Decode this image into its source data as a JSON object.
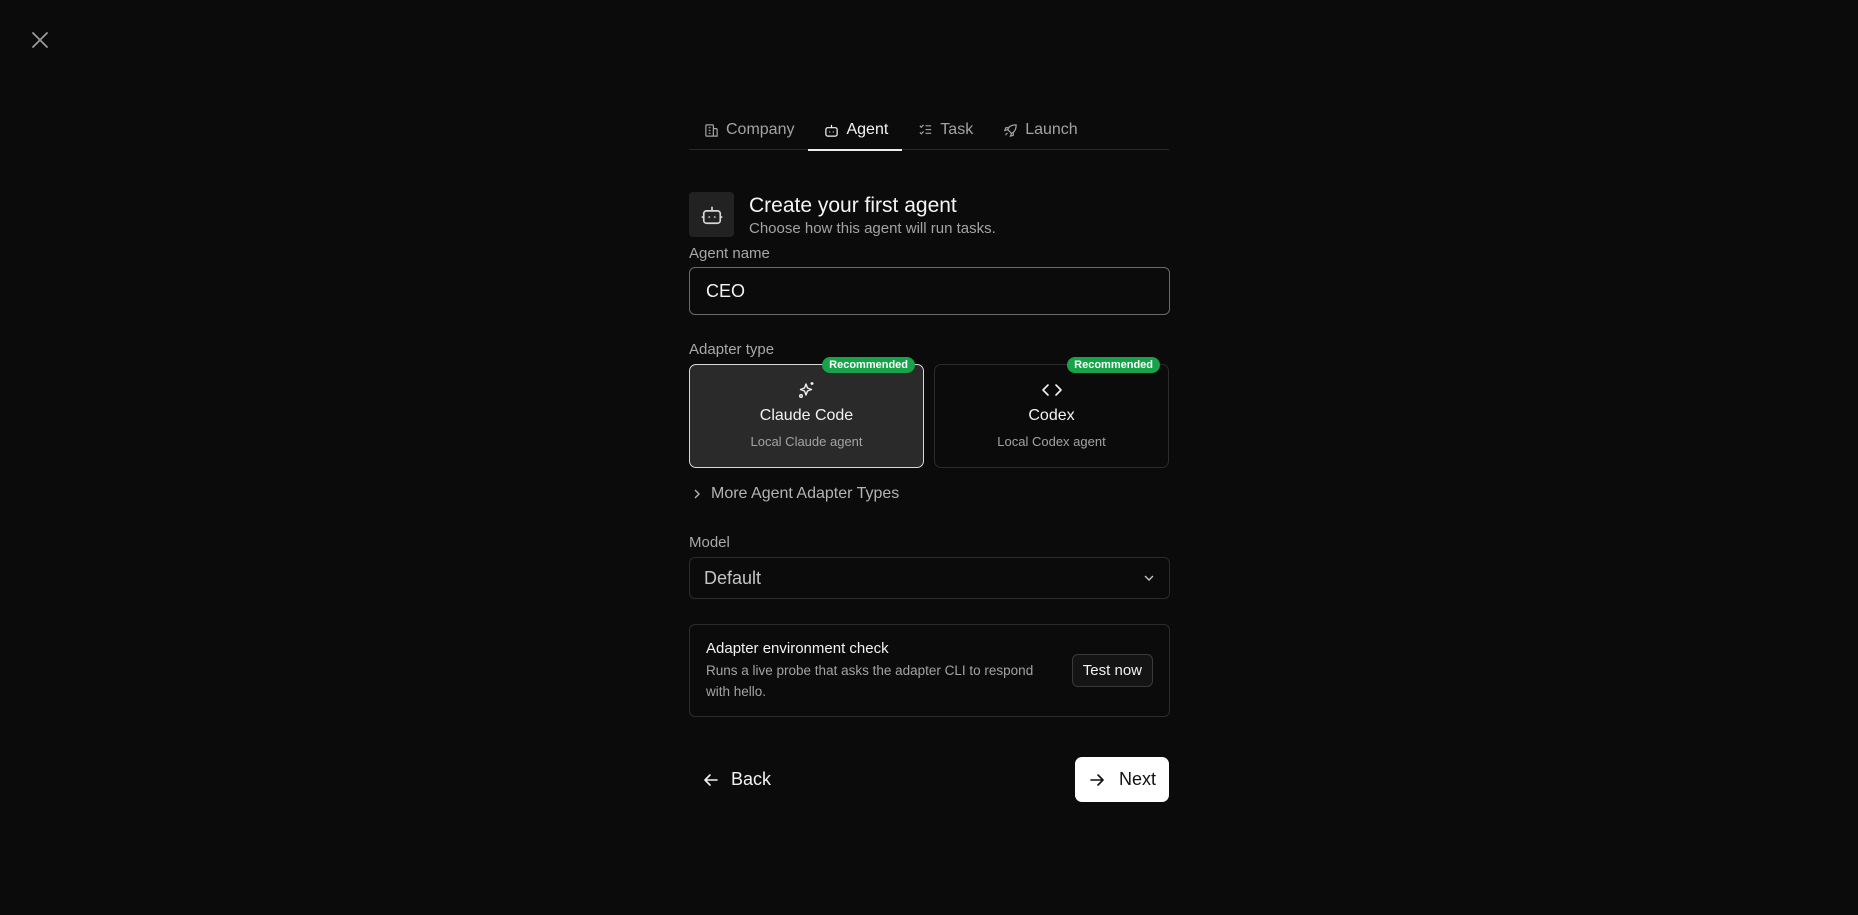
{
  "tabs": [
    {
      "label": "Company",
      "icon": "building-icon"
    },
    {
      "label": "Agent",
      "icon": "bot-icon",
      "active": true
    },
    {
      "label": "Task",
      "icon": "list-checks-icon"
    },
    {
      "label": "Launch",
      "icon": "rocket-icon"
    }
  ],
  "header": {
    "title": "Create your first agent",
    "subtitle": "Choose how this agent will run tasks."
  },
  "agent_name": {
    "label": "Agent name",
    "value": "CEO"
  },
  "adapter": {
    "label": "Adapter type",
    "options": [
      {
        "name": "Claude Code",
        "desc": "Local Claude agent",
        "badge": "Recommended",
        "icon": "sparkles-icon",
        "selected": true
      },
      {
        "name": "Codex",
        "desc": "Local Codex agent",
        "badge": "Recommended",
        "icon": "code-icon",
        "selected": false
      }
    ],
    "more_label": "More Agent Adapter Types"
  },
  "model": {
    "label": "Model",
    "value": "Default"
  },
  "env_check": {
    "title": "Adapter environment check",
    "desc": "Runs a live probe that asks the adapter CLI to respond with hello.",
    "button": "Test now"
  },
  "footer": {
    "back": "Back",
    "next": "Next"
  },
  "colors": {
    "badge": "#16a34a",
    "background": "#0b0b0b",
    "accent": "#ffffff"
  }
}
